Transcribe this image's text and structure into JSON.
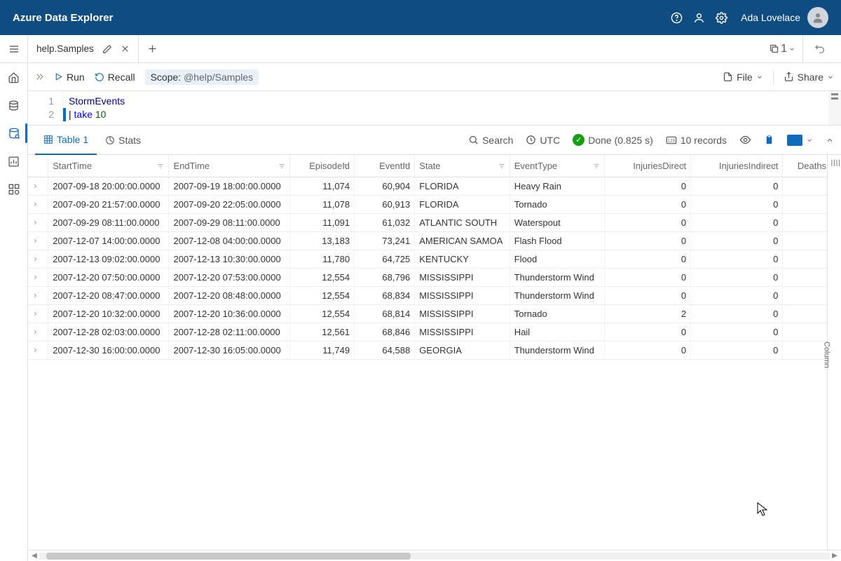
{
  "header": {
    "title": "Azure Data Explorer",
    "user": "Ada Lovelace"
  },
  "tabs": {
    "active_name": "help.Samples",
    "copy_count": "1"
  },
  "toolbar": {
    "run": "Run",
    "recall": "Recall",
    "scope_label": "Scope:",
    "scope_value": "@help/Samples",
    "file": "File",
    "share": "Share"
  },
  "editor": {
    "line1": {
      "table": "StormEvents"
    },
    "line2": {
      "op": "take",
      "num": "10"
    }
  },
  "results": {
    "tab_table": "Table 1",
    "tab_stats": "Stats",
    "search": "Search",
    "tz": "UTC",
    "status": "Done (0.825 s)",
    "records": "10 records",
    "columns_label": "Column"
  },
  "cols": {
    "c0": "StartTime",
    "c1": "EndTime",
    "c2": "EpisodeId",
    "c3": "EventId",
    "c4": "State",
    "c5": "EventType",
    "c6": "InjuriesDirect",
    "c7": "InjuriesIndirect",
    "c8": "DeathsDirect"
  },
  "rows": [
    {
      "c0": "2007-09-18 20:00:00.0000",
      "c1": "2007-09-19 18:00:00.0000",
      "c2": "11,074",
      "c3": "60,904",
      "c4": "FLORIDA",
      "c5": "Heavy Rain",
      "c6": "0",
      "c7": "0"
    },
    {
      "c0": "2007-09-20 21:57:00.0000",
      "c1": "2007-09-20 22:05:00.0000",
      "c2": "11,078",
      "c3": "60,913",
      "c4": "FLORIDA",
      "c5": "Tornado",
      "c6": "0",
      "c7": "0"
    },
    {
      "c0": "2007-09-29 08:11:00.0000",
      "c1": "2007-09-29 08:11:00.0000",
      "c2": "11,091",
      "c3": "61,032",
      "c4": "ATLANTIC SOUTH",
      "c5": "Waterspout",
      "c6": "0",
      "c7": "0"
    },
    {
      "c0": "2007-12-07 14:00:00.0000",
      "c1": "2007-12-08 04:00:00.0000",
      "c2": "13,183",
      "c3": "73,241",
      "c4": "AMERICAN SAMOA",
      "c5": "Flash Flood",
      "c6": "0",
      "c7": "0"
    },
    {
      "c0": "2007-12-13 09:02:00.0000",
      "c1": "2007-12-13 10:30:00.0000",
      "c2": "11,780",
      "c3": "64,725",
      "c4": "KENTUCKY",
      "c5": "Flood",
      "c6": "0",
      "c7": "0"
    },
    {
      "c0": "2007-12-20 07:50:00.0000",
      "c1": "2007-12-20 07:53:00.0000",
      "c2": "12,554",
      "c3": "68,796",
      "c4": "MISSISSIPPI",
      "c5": "Thunderstorm Wind",
      "c6": "0",
      "c7": "0"
    },
    {
      "c0": "2007-12-20 08:47:00.0000",
      "c1": "2007-12-20 08:48:00.0000",
      "c2": "12,554",
      "c3": "68,834",
      "c4": "MISSISSIPPI",
      "c5": "Thunderstorm Wind",
      "c6": "0",
      "c7": "0"
    },
    {
      "c0": "2007-12-20 10:32:00.0000",
      "c1": "2007-12-20 10:36:00.0000",
      "c2": "12,554",
      "c3": "68,814",
      "c4": "MISSISSIPPI",
      "c5": "Tornado",
      "c6": "2",
      "c7": "0"
    },
    {
      "c0": "2007-12-28 02:03:00.0000",
      "c1": "2007-12-28 02:11:00.0000",
      "c2": "12,561",
      "c3": "68,846",
      "c4": "MISSISSIPPI",
      "c5": "Hail",
      "c6": "0",
      "c7": "0"
    },
    {
      "c0": "2007-12-30 16:00:00.0000",
      "c1": "2007-12-30 16:05:00.0000",
      "c2": "11,749",
      "c3": "64,588",
      "c4": "GEORGIA",
      "c5": "Thunderstorm Wind",
      "c6": "0",
      "c7": "0"
    }
  ]
}
